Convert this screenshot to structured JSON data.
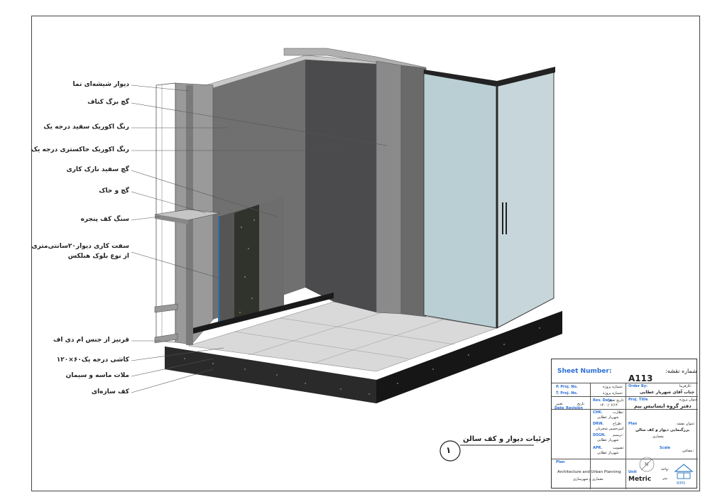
{
  "drawing": {
    "callouts": [
      "دیوار شیشه‌ای نما",
      "گچ برگ کناف",
      "رنگ اکوریک سفید درجه یک",
      "رنگ اکوریک خاکستری درجه یک",
      "گچ سفید نازک کاری",
      "گچ و خاک",
      "سنگ کف پنجره",
      "سفت کاری دیوار۲۰سانتی‌متری",
      "از نوع بلوک هبلکس",
      "قرنیز از جنس ام دی اف",
      "کاشی درجه یک۶۰×۱۲۰",
      "ملات ماسه و سیمان",
      "کف سازه‌ای"
    ],
    "view_number": "۱",
    "view_title": "جزئیات دیوار و کف سالن"
  },
  "title_block": {
    "sheet_number_label": "Sheet Number:",
    "sheet_number_fa": "شماره نقشه:",
    "sheet_number": "A113",
    "p_proj_no_label": "P. Proj. No.",
    "p_proj_no_fa": "شماره پروژه:",
    "t_proj_no_label": "T. Proj. No.",
    "t_proj_no_fa": "شماره پروژه:",
    "order_by_label": "Order By:",
    "order_by_fa": "کارفرما:",
    "client": "جناب آقای شهریار عطایی",
    "proj_title_label": "Proj. Title",
    "proj_title_fa": "عنوان پروژه:",
    "proj_title": "دفتر گروه ایساتیس بیم",
    "rev_date_label": "Rev. Date",
    "rev_date_fa": "تاریخ تغییر:",
    "rev_date": "۱۴۰۰/۰۶/۱۴",
    "date_label": "Date",
    "revision_label": "Revision",
    "date_fa": "تاریخ",
    "revision_fa": "تغییر",
    "chk_label": "CHK.",
    "chk_fa": "نظارت:",
    "chk_name": "شهریار عطایی",
    "drw_label": "DRW.",
    "drw_fa": "طراح:",
    "drw_name": "امیرحسین شجریان",
    "dsgn_label": "DSGN.",
    "dsgn_fa": "ترسیم:",
    "dsgn_name": "شهریار عطایی",
    "apr_label": "APR.",
    "apr_fa": "تصویب:",
    "apr_name": "شهریار عطایی",
    "plan_label": "Plan",
    "plan_title_fa": "عنوان نقشه:",
    "plan_title": "بزرگنمایی دیوار و کف سالن",
    "discipline": "معماری",
    "scale_label": "Scale",
    "scale_fa": "مقیاس:",
    "plan_label2": "Plan",
    "office_en": "Architecture and Urban Planning",
    "office_fa": "معماری و شهرسازی",
    "unit_label": "Unit",
    "unit_fa": "واحد:",
    "unit": "Metric",
    "unit_fa2": "متر",
    "logo_text": "BIMS"
  }
}
